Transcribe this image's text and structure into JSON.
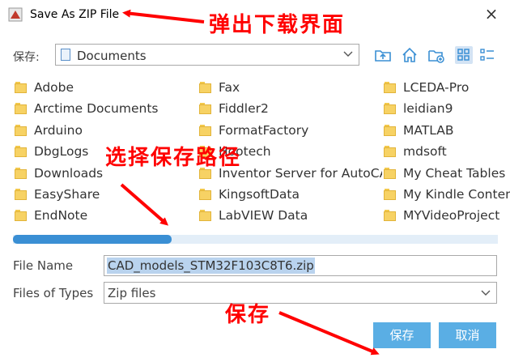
{
  "window": {
    "title": "Save As ZIP File",
    "close_glyph": "×"
  },
  "toolbar": {
    "save_in_label": "保存:",
    "location": "Documents",
    "icons": [
      "folder-up-icon",
      "home-icon",
      "new-folder-icon",
      "list-view-icon",
      "details-view-icon"
    ]
  },
  "files": {
    "col1": [
      "Adobe",
      "Arctime Documents",
      "Arduino",
      "DbgLogs",
      "Downloads",
      "EasyShare",
      "EndNote"
    ],
    "col2": [
      "Fax",
      "Fiddler2",
      "FormatFactory",
      "Hootech",
      "Inventor Server for AutoCAD",
      "KingsoftData",
      "LabVIEW Data"
    ],
    "col3": [
      "LCEDA-Pro",
      "leidian9",
      "MATLAB",
      "mdsoft",
      "My Cheat Tables",
      "My Kindle Content",
      "MYVideoProject"
    ]
  },
  "form": {
    "file_name_label": "File Name",
    "file_name_value": "CAD_models_STM32F103C8T6.zip",
    "file_types_label": "Files of Types",
    "file_types_value": "Zip files"
  },
  "buttons": {
    "save": "保存",
    "cancel": "取消"
  },
  "annotations": {
    "popup": "弹出下载界面",
    "choose_path": "选择保存路径",
    "save": "保存",
    "color": "#ff0000"
  },
  "colors": {
    "accent": "#5aaee4",
    "scroll_thumb": "#3a8fd4",
    "selection": "#b9d3ee",
    "folder": "#f7d264"
  }
}
